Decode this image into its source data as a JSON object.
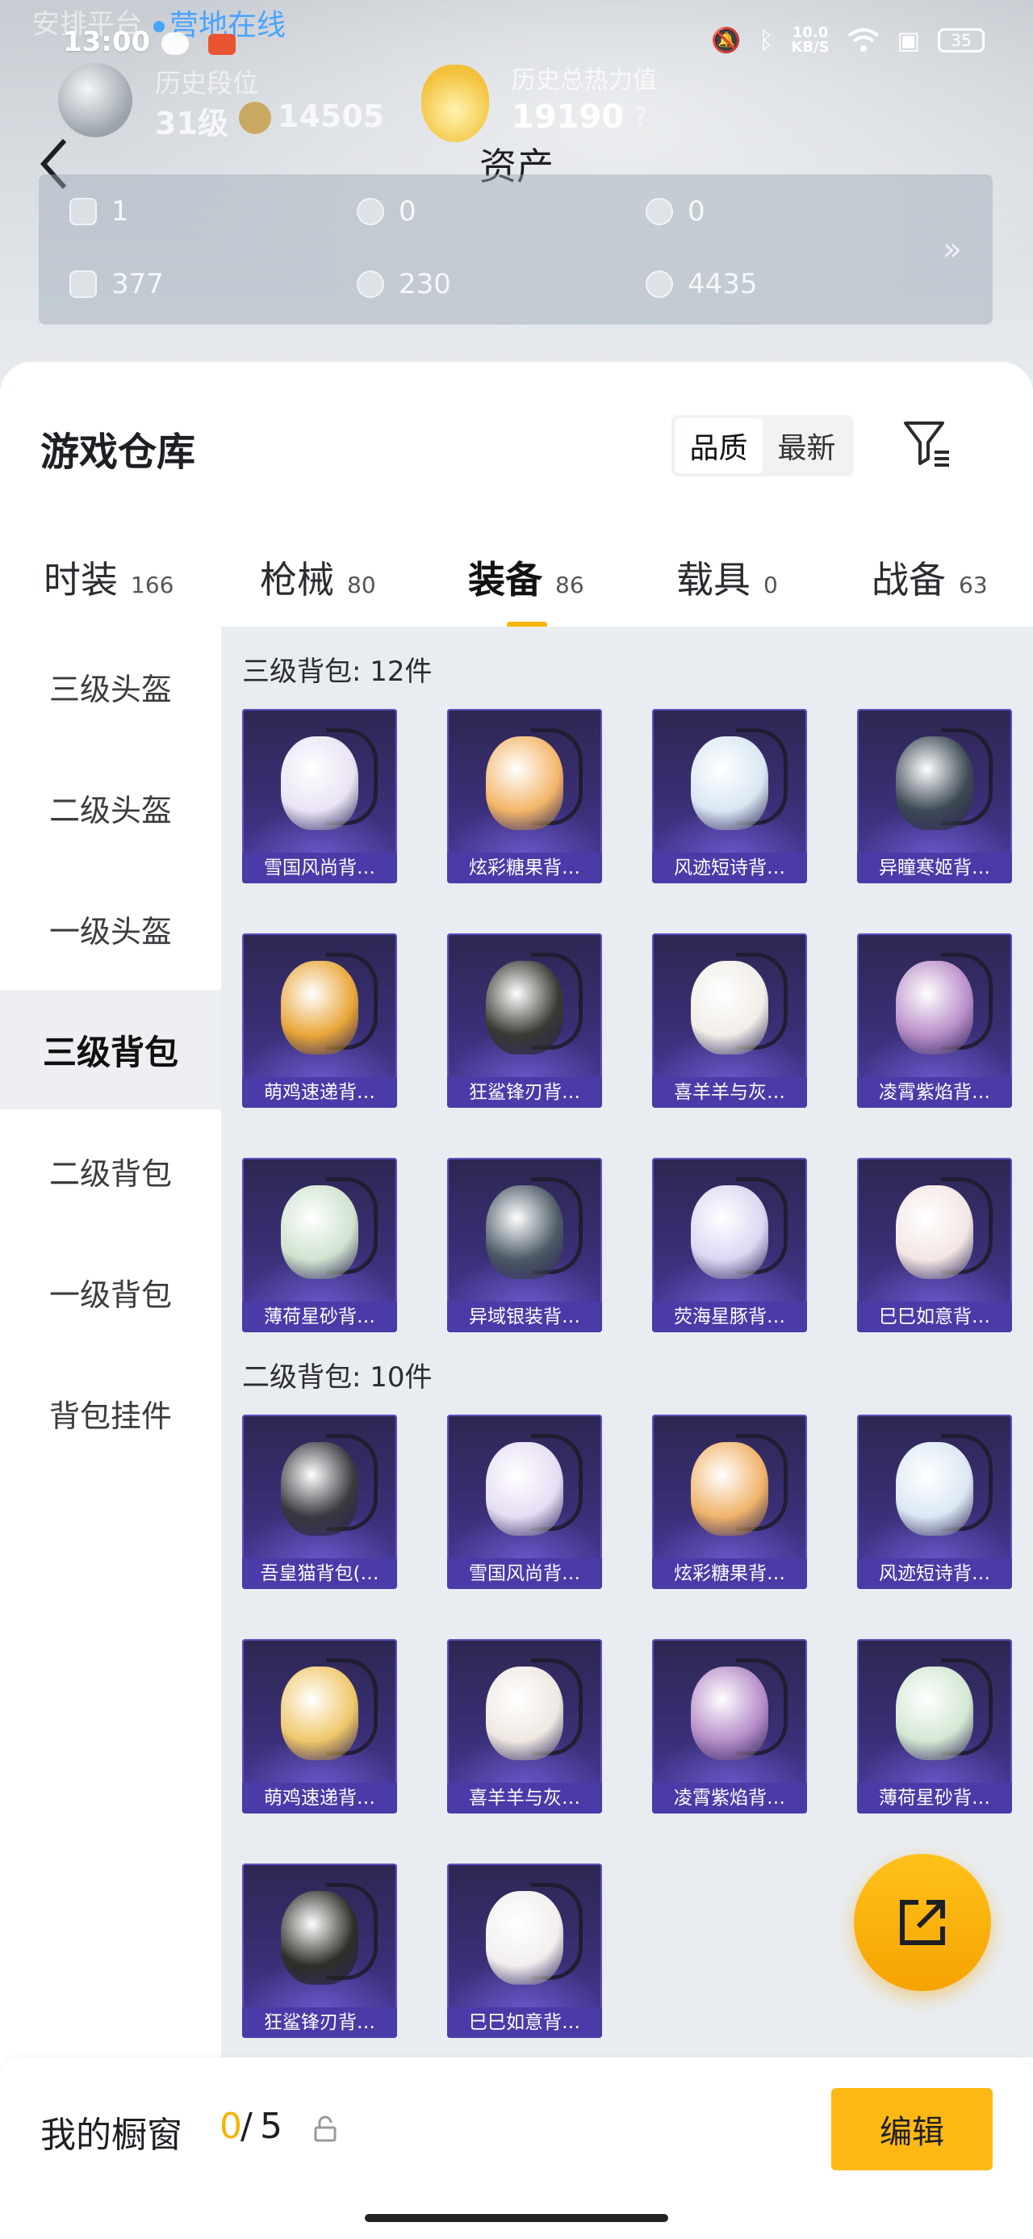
{
  "status_bar": {
    "time": "13:00",
    "faded_text": "安排平台",
    "online_text": "营地在线",
    "net_speed": "10.0",
    "net_unit": "KB/S",
    "battery": "35"
  },
  "profile": {
    "title_faded": "历史段位",
    "level": "31级",
    "coins": "14505",
    "heat_label": "历史总热力值",
    "heat_value": "19190",
    "heat_hint": "?"
  },
  "header": {
    "back_icon": "chevron-left-icon",
    "title": "资产"
  },
  "assets": [
    {
      "icon": "card-icon",
      "value": "1"
    },
    {
      "icon": "medal-icon",
      "value": "0"
    },
    {
      "icon": "badge-icon",
      "value": "0"
    },
    {
      "icon": "ticket-icon",
      "value": "377"
    },
    {
      "icon": "orb-icon",
      "value": "230"
    },
    {
      "icon": "coin-icon",
      "value": "4435"
    }
  ],
  "assets_more": "»",
  "warehouse": {
    "title": "游戏仓库",
    "sort": {
      "quality": "品质",
      "latest": "最新"
    },
    "filter_icon": "filter-icon"
  },
  "tabs": [
    {
      "label": "时装",
      "count": "166"
    },
    {
      "label": "枪械",
      "count": "80"
    },
    {
      "label": "装备",
      "count": "86",
      "active": true
    },
    {
      "label": "载具",
      "count": "0"
    },
    {
      "label": "战备",
      "count": "63"
    }
  ],
  "categories": [
    "三级头盔",
    "二级头盔",
    "一级头盔",
    "三级背包",
    "二级背包",
    "一级背包",
    "背包挂件"
  ],
  "active_category": "三级背包",
  "sections": [
    {
      "title": "三级背包: 12件",
      "items": [
        {
          "name": "雪国风尚背…",
          "color": "#e9e3f4"
        },
        {
          "name": "炫彩糖果背…",
          "color": "#f3b66a"
        },
        {
          "name": "风迹短诗背…",
          "color": "#d9e7f3"
        },
        {
          "name": "异瞳寒姬背…",
          "color": "#3d4a55"
        },
        {
          "name": "萌鸡速递背…",
          "color": "#e9a63a"
        },
        {
          "name": "狂鲨锋刃背…",
          "color": "#3a3a34"
        },
        {
          "name": "喜羊羊与灰…",
          "color": "#f1ede8"
        },
        {
          "name": "凌霄紫焰背…",
          "color": "#b98ec9"
        },
        {
          "name": "薄荷星砂背…",
          "color": "#cfe3cf"
        },
        {
          "name": "异域银装背…",
          "color": "#4c5a66"
        },
        {
          "name": "荧海星豚背…",
          "color": "#dcd6f2"
        },
        {
          "name": "巳巳如意背…",
          "color": "#f3e6e4"
        }
      ]
    },
    {
      "title": "二级背包: 10件",
      "items": [
        {
          "name": "吾皇猫背包(…",
          "color": "#3a3a40"
        },
        {
          "name": "雪国风尚背…",
          "color": "#e6ddf3"
        },
        {
          "name": "炫彩糖果背…",
          "color": "#f0b36a"
        },
        {
          "name": "风迹短诗背…",
          "color": "#dbe8f4"
        },
        {
          "name": "萌鸡速递背…",
          "color": "#f0c76a"
        },
        {
          "name": "喜羊羊与灰…",
          "color": "#efe8e2"
        },
        {
          "name": "凌霄紫焰背…",
          "color": "#b58cc8"
        },
        {
          "name": "薄荷星砂背…",
          "color": "#d3e8d3"
        },
        {
          "name": "狂鲨锋刃背…",
          "color": "#2f2f2a"
        },
        {
          "name": "巳巳如意背…",
          "color": "#f2eeee"
        }
      ]
    }
  ],
  "fab_icon": "external-link-icon",
  "showcase": {
    "label": "我的橱窗",
    "current": "0",
    "separator": "/",
    "max": "5",
    "lock_icon": "lock-icon",
    "edit_label": "编辑"
  },
  "colors": {
    "accent": "#f5b400",
    "card_bg": "#3a2f76",
    "card_label_bg": "#4a3ba8"
  }
}
